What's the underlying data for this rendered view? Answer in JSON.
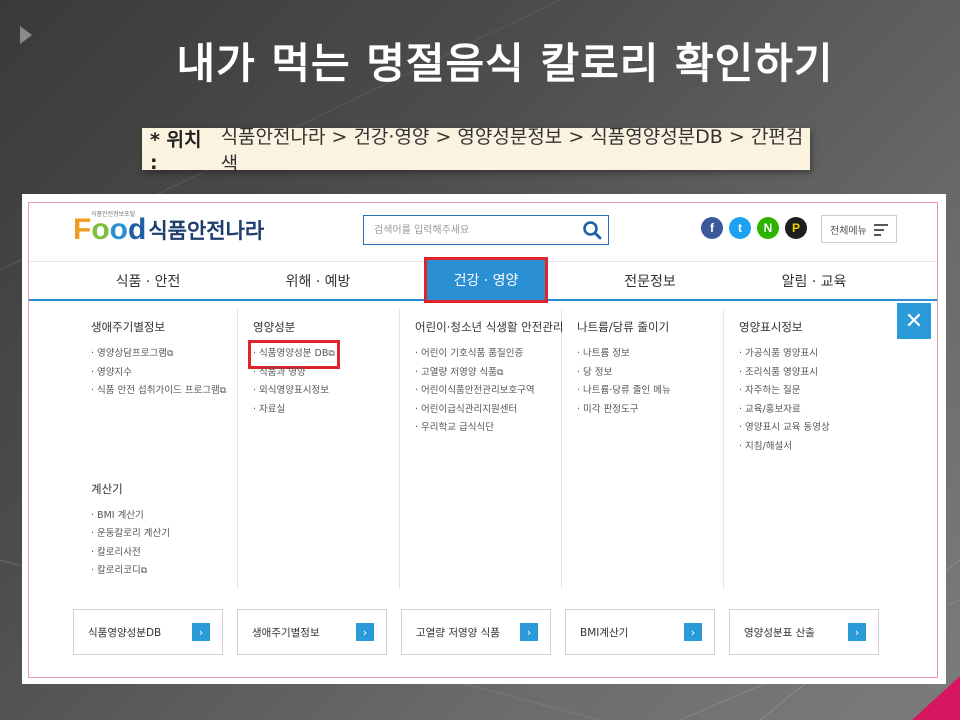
{
  "slide": {
    "title": "내가 먹는 명절음식 칼로리 확인하기",
    "location_label": "* 위치 :",
    "location_path": "식품안전나라 > 건강·영양 > 영양성분정보 > 식품영양성분DB > 간편검색"
  },
  "site": {
    "logo_food": [
      "F",
      "o",
      "o",
      "d"
    ],
    "logo_name": "식품안전나라",
    "logo_tagline": "식품안전정보포털",
    "search_placeholder": "검색어를 입력해주세요",
    "sns": [
      {
        "name": "facebook",
        "glyph": "f",
        "color": "#3b5998"
      },
      {
        "name": "twitter",
        "glyph": "t",
        "color": "#1da1f2"
      },
      {
        "name": "blog",
        "glyph": "N",
        "color": "#2db400"
      },
      {
        "name": "kakao",
        "glyph": "P",
        "color": "#3c1e1e"
      }
    ],
    "all_menu_label": "전체메뉴",
    "accent_color": "#2b8fd4",
    "highlight_color": "#e0242b"
  },
  "gnb": [
    {
      "label": "식품 · 안전",
      "active": false
    },
    {
      "label": "위해 · 예방",
      "active": false
    },
    {
      "label": "건강 · 영양",
      "active": true
    },
    {
      "label": "전문정보",
      "active": false
    },
    {
      "label": "알림 · 교육",
      "active": false
    }
  ],
  "mega": {
    "col1": {
      "title": "생애주기별정보",
      "items": [
        "영양상담프로그램",
        "영양지수",
        "식품 안전 섭취가이드 프로그램"
      ],
      "title2": "계산기",
      "items2": [
        "BMI 계산기",
        "운동칼로리 계산기",
        "칼로리사전",
        "칼로리코디"
      ]
    },
    "col2": {
      "title": "영양성분",
      "items": [
        "식품영양성분 DB",
        "식품과 영양",
        "외식영양표시정보",
        "자료실"
      ]
    },
    "col3": {
      "title": "어린이·청소년 식생활 안전관리",
      "items": [
        "어린이 기호식품 품질인증",
        "고열량 저영양 식품",
        "어린이식품안전관리보호구역",
        "어린이급식관리지원센터",
        "우리학교 급식식단"
      ]
    },
    "col4": {
      "title": "나트륨/당류 줄이기",
      "items": [
        "나트륨 정보",
        "당 정보",
        "나트륨·당류 줄인 메뉴",
        "미각 판정도구"
      ]
    },
    "col5": {
      "title": "영양표시정보",
      "items": [
        "가공식품 영양표시",
        "조리식품 영양표시",
        "자주하는 질문",
        "교육/홍보자료",
        "영양표시 교육 동영상",
        "지침/해설서"
      ]
    }
  },
  "quick_links": [
    "식품영양성분DB",
    "생애주기별정보",
    "고열량 저영양 식품",
    "BMI계산기",
    "영양성분표 산출"
  ]
}
